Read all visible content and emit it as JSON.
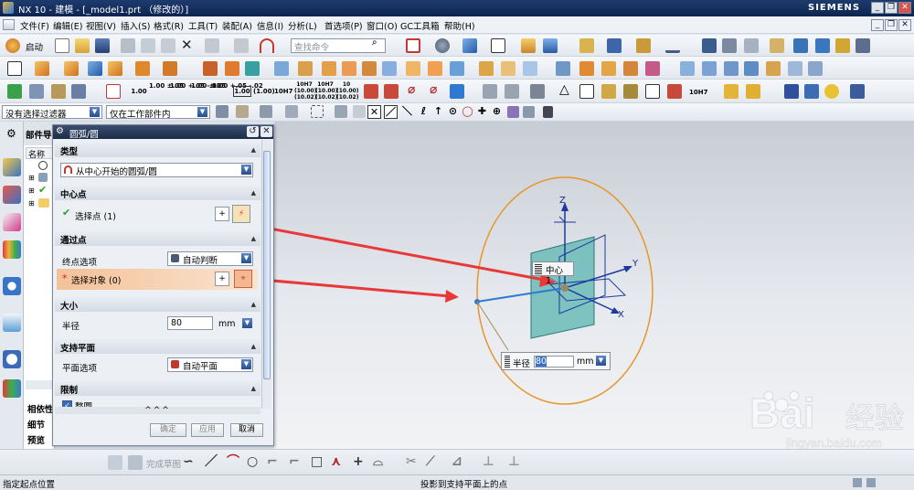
{
  "window": {
    "title": "NX 10 - 建模 - [_model1.prt （修改的）]",
    "brand": "SIEMENS",
    "minimize": "_",
    "restore": "❐",
    "close": "✕"
  },
  "menubar": {
    "items": [
      "文件(F)",
      "编辑(E)",
      "视图(V)",
      "插入(S)",
      "格式(R)",
      "工具(T)",
      "装配(A)",
      "信息(I)",
      "分析(L)",
      "首选项(P)",
      "窗口(O)",
      "GC工具箱",
      "帮助(H)"
    ],
    "doc_minimize": "_",
    "doc_restore": "❐",
    "doc_close": "✕"
  },
  "toolbar1": {
    "start_label": "启动",
    "search_placeholder": "查找命令"
  },
  "toolbar3": {
    "tolerance_labels": [
      "1.00",
      "1.00 ±.05",
      "1.00 +.05 -.02",
      "1.00 ±.05",
      "1.00 +.05 -.02",
      "1.00",
      "(1.00)",
      "10H7",
      "10H7 (10.00) (10.02)",
      "10H7 (10.00) (10.02)",
      "10 (10.00) (10.02)"
    ],
    "fit_label": "10H7"
  },
  "selectionbar": {
    "filter_value": "没有选择过滤器",
    "scope_value": "仅在工作部件内"
  },
  "navigator": {
    "title": "部件导",
    "column_name": "名称",
    "bottom_items": [
      "相依性",
      "细节",
      "预览"
    ]
  },
  "dialog": {
    "title": "圆弧/圆",
    "reset_icon": "↺",
    "close_icon": "✕",
    "type_section": "类型",
    "type_value": "从中心开始的圆弧/圆",
    "center_section": "中心点",
    "center_select": "选择点 (1)",
    "through_section": "通过点",
    "endpoint_label": "终点选项",
    "endpoint_value": "自动判断",
    "through_select": "选择对象 (0)",
    "size_section": "大小",
    "radius_label": "半径",
    "radius_value": "80",
    "radius_unit": "mm",
    "plane_section": "支持平面",
    "plane_label": "平面选项",
    "plane_value": "自动平面",
    "limit_section": "限制",
    "limit_check": "整圆",
    "more_label": "^^^",
    "ok_button": "确定",
    "apply_button": "应用",
    "cancel_button": "取消"
  },
  "graphics": {
    "center_tag": "中心 1",
    "axis_z": "Z",
    "axis_y": "Y",
    "axis_x": "X",
    "radius_label": "半径",
    "radius_value": "80",
    "radius_unit": "mm",
    "watermark_brand": "Bai",
    "watermark_cn": "经验",
    "watermark_url": "jingyan.baidu.com"
  },
  "sketchbar": {
    "finish_label": "完成草图"
  },
  "statusbar": {
    "left_text": "指定起点位置",
    "center_text": "投影到支持平面上的点"
  },
  "colors": {
    "accent_blue": "#2f6fcf",
    "arc_orange": "#e8962b",
    "arrow_red": "#e8383a",
    "plane_teal": "#5bb5b0",
    "highlight_row": "#f3c198"
  }
}
